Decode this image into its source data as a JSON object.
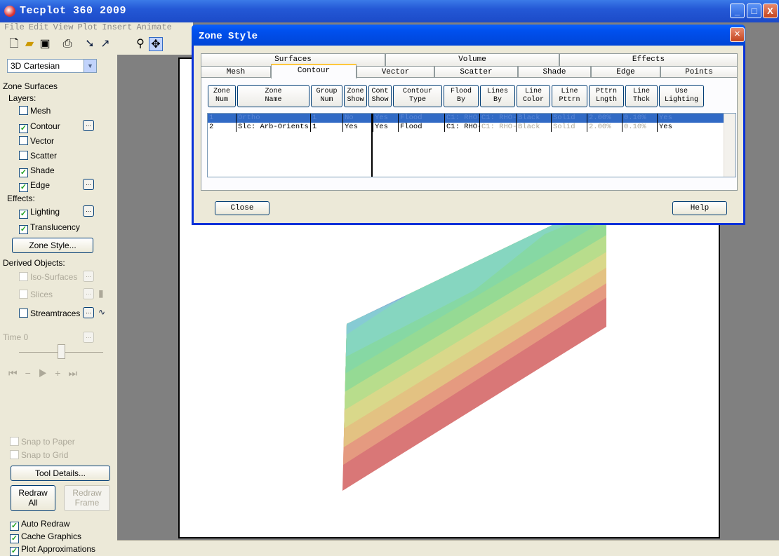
{
  "window": {
    "title": "Tecplot 360 2009",
    "controls": [
      "_",
      "□",
      "X"
    ]
  },
  "menu": [
    "File",
    "Edit",
    "View",
    "Plot",
    "Insert",
    "Animate"
  ],
  "plot_mode": "3D Cartesian",
  "side": {
    "zone_surfaces": "Zone Surfaces",
    "layers": "Layers:",
    "mesh": "Mesh",
    "contour": "Contour",
    "vector": "Vector",
    "scatter": "Scatter",
    "shade": "Shade",
    "edge": "Edge",
    "effects": "Effects:",
    "lighting": "Lighting",
    "translucency": "Translucency",
    "zone_style": "Zone Style...",
    "derived": "Derived Objects:",
    "iso": "Iso-Surfaces",
    "slices": "Slices",
    "streamtraces": "Streamtraces",
    "time": "Time  0",
    "snap_paper": "Snap to Paper",
    "snap_grid": "Snap to Grid",
    "tool_details": "Tool Details...",
    "redraw_all_1": "Redraw",
    "redraw_all_2": "All",
    "redraw_frame_1": "Redraw",
    "redraw_frame_2": "Frame",
    "auto_redraw": "Auto Redraw",
    "cache": "Cache Graphics",
    "approx": "Plot Approximations",
    "more": "...",
    "check": "✓"
  },
  "dialog": {
    "title": "Zone Style",
    "tabs_top": [
      "Surfaces",
      "Volume",
      "Effects"
    ],
    "tabs_bottom": [
      "Mesh",
      "Contour",
      "Vector",
      "Scatter",
      "Shade",
      "Edge",
      "Points"
    ],
    "columns": [
      [
        "Zone",
        "Num"
      ],
      [
        "Zone",
        "Name"
      ],
      [
        "Group",
        "Num"
      ],
      [
        "Zone",
        "Show"
      ],
      [
        "Cont",
        "Show"
      ],
      [
        "Contour",
        "Type"
      ],
      [
        "Flood",
        "By"
      ],
      [
        "Lines",
        "By"
      ],
      [
        "Line",
        "Color"
      ],
      [
        "Line",
        "Pttrn"
      ],
      [
        "Pttrn",
        "Lngth"
      ],
      [
        "Line",
        "Thck"
      ],
      [
        "Use",
        "Lighting"
      ]
    ],
    "rows": [
      [
        "1",
        "Ortho",
        "1",
        "No",
        "Yes",
        "Flood",
        "C1: RHO-",
        "C1: RHO-",
        "Black",
        "Solid",
        "2.00%",
        "0.10%",
        "Yes"
      ],
      [
        "2",
        "Slc: Arb-Orients",
        "1",
        "Yes",
        "Yes",
        "Flood",
        "C1: RHO-",
        "C1: RHO-",
        "Black",
        "Solid",
        "2.00%",
        "0.10%",
        "Yes"
      ]
    ],
    "close": "Close",
    "help": "Help"
  }
}
